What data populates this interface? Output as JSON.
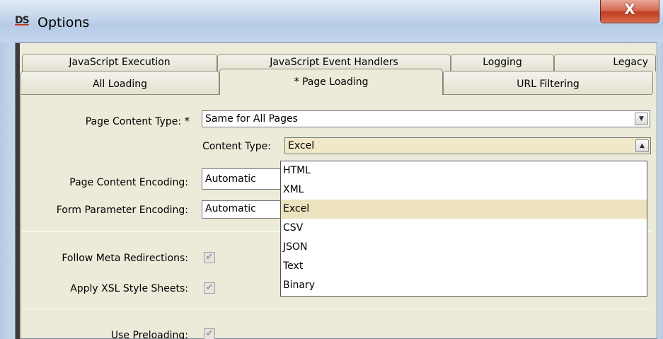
{
  "window": {
    "app_icon_text": "DS",
    "title": "Options",
    "close_glyph": "X"
  },
  "tabs": {
    "row_top": [
      "JavaScript Execution",
      "JavaScript Event Handlers",
      "Logging",
      "Legacy"
    ],
    "row_bottom": [
      "All Loading",
      "Page Loading",
      "URL Filtering"
    ],
    "active": "Page Loading",
    "modified_marker": "*"
  },
  "form": {
    "page_content_type": {
      "label": "Page Content Type:",
      "marker": "*",
      "value": "Same for All Pages"
    },
    "content_type": {
      "label": "Content Type:",
      "value": "Excel"
    },
    "page_content_encoding": {
      "label": "Page Content Encoding:",
      "value": "Automatic"
    },
    "form_parameter_encoding": {
      "label": "Form Parameter Encoding:",
      "value": "Automatic"
    },
    "follow_meta_redirections": {
      "label": "Follow Meta Redirections:",
      "checked": true
    },
    "apply_xsl_style_sheets": {
      "label": "Apply XSL Style Sheets:",
      "checked": true
    },
    "use_preloading": {
      "label": "Use Preloading:",
      "checked": true
    }
  },
  "dropdown": {
    "options": [
      "HTML",
      "XML",
      "Excel",
      "CSV",
      "JSON",
      "Text",
      "Binary"
    ],
    "selected": "Excel"
  },
  "icons": {
    "combo_arrow_down": "chevron-down-icon",
    "combo_arrow_up": "chevron-up-icon",
    "checkbox_mark": "checkmark-icon"
  },
  "colors": {
    "dialog_background": "#ecead9",
    "selected_option": "#ece2bd",
    "close_button": "#c23e22"
  }
}
